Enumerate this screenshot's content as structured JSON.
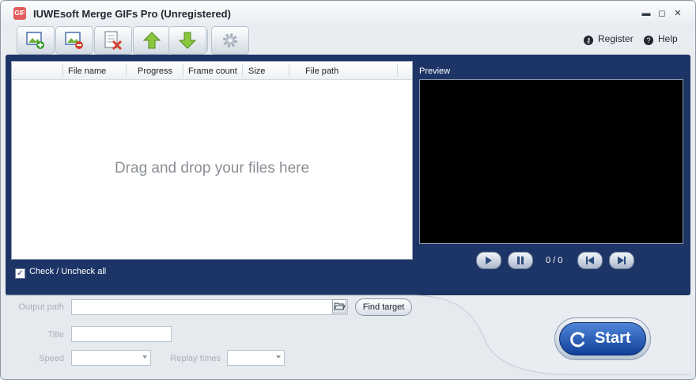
{
  "window": {
    "app_icon_text": "GIF",
    "title": "IUWEsoft Merge GIFs Pro (Unregistered)",
    "minimize_glyph": "▬",
    "maximize_glyph": "◻",
    "close_glyph": "✕"
  },
  "toolbar": {
    "buttons": [
      {
        "name": "add-file",
        "icon": "image-add-icon"
      },
      {
        "name": "remove-file",
        "icon": "image-remove-icon"
      },
      {
        "name": "clear-list",
        "icon": "clear-list-icon"
      },
      {
        "name": "move-up",
        "icon": "arrow-up-icon"
      },
      {
        "name": "move-down",
        "icon": "arrow-down-icon"
      },
      {
        "name": "settings",
        "icon": "gear-icon"
      }
    ],
    "register_label": "Register",
    "help_label": "Help"
  },
  "file_list": {
    "columns": [
      "File name",
      "Progress",
      "Frame count",
      "Size",
      "File path"
    ],
    "drop_hint": "Drag and drop your files here",
    "check_all_label": "Check / Uncheck all"
  },
  "preview": {
    "label": "Preview",
    "frame_counter": "0 / 0"
  },
  "settings_form": {
    "output_path_label": "Output path",
    "output_path_value": "",
    "find_target_label": "Find target",
    "title_label": "Title",
    "title_value": "",
    "speed_label": "Speed",
    "speed_value": "",
    "replay_times_label": "Replay times",
    "replay_times_value": ""
  },
  "start_button": {
    "label": "Start"
  },
  "colors": {
    "panel_navy": "#1d3566",
    "start_blue": "#1b4aa6"
  }
}
